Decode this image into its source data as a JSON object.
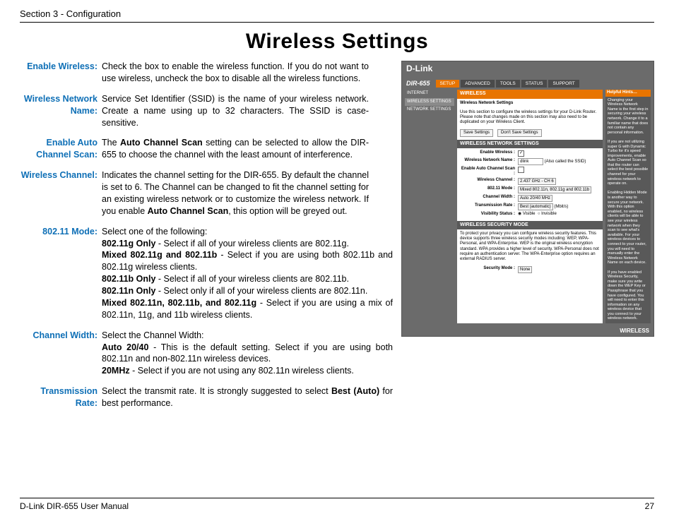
{
  "header": {
    "section": "Section 3 - Configuration"
  },
  "title": "Wireless Settings",
  "defs": [
    {
      "term": "Enable Wireless:",
      "html": "Check the box to enable the wireless function. If you do not want to use wireless, uncheck the box to disable all the wireless functions.",
      "narrow": true
    },
    {
      "term": "Wireless Network Name:",
      "html": "Service Set Identifier (SSID) is the name of your wireless network. Create a name using up to 32 characters. The SSID is case-sensitive.",
      "narrow": true
    },
    {
      "term": "Enable Auto Channel Scan:",
      "html": "The <b>Auto Channel Scan</b> setting can be selected to allow the DIR-655 to choose the channel with the least amount of interference.",
      "narrow": true
    },
    {
      "term": "Wireless Channel:",
      "html": "Indicates the channel setting for the DIR-655. By default the channel is set to 6. The Channel can be changed to fit the channel setting for an existing wireless network or to customize the wireless network. If you enable <b>Auto Channel Scan</b>, this option will be greyed out.",
      "narrow": true
    },
    {
      "term": "802.11 Mode:",
      "html": "Select one of the following:<br><b>802.11g Only</b> - Select if all of your wireless clients are 802.11g.<br><b>Mixed 802.11g and 802.11b</b> - Select if you are using both 802.11b and 802.11g wireless clients.<br><b>802.11b Only</b> - Select if all of your wireless clients are 802.11b.<br><b>802.11n Only</b> - Select only if all of your wireless clients are 802.11n.<br><b>Mixed 802.11n, 802.11b, and 802.11g</b> - Select if you are using a mix of 802.11n, 11g, and 11b wireless clients.",
      "narrow": false
    },
    {
      "term": "Channel Width:",
      "html": "Select the Channel Width:<br><b>Auto 20/40</b> - This is the default setting. Select if you are using both 802.11n and non-802.11n wireless devices.<br><b>20MHz</b> - Select if you are not using any 802.11n wireless clients.",
      "narrow": false
    },
    {
      "term": "Transmission Rate:",
      "html": "Select the transmit rate. It is strongly suggested to select <b>Best (Auto)</b> for best performance.",
      "narrow": false
    }
  ],
  "screenshot": {
    "brand": "D-Link",
    "model": "DIR-655",
    "tabs": [
      "SETUP",
      "ADVANCED",
      "TOOLS",
      "STATUS",
      "SUPPORT"
    ],
    "activeTab": "SETUP",
    "side": [
      "INTERNET",
      "WIRELESS SETTINGS",
      "NETWORK SETTINGS"
    ],
    "sideActive": "WIRELESS SETTINGS",
    "mainBar": "WIRELESS",
    "subBar": "Wireless Network Settings",
    "intro": "Use this section to configure the wireless settings for your D-Link Router. Please note that changes made on this section may also need to be duplicated on your Wireless Client.",
    "btnSave": "Save Settings",
    "btnDont": "Don't Save Settings",
    "panel1": "WIRELESS NETWORK SETTINGS",
    "form": {
      "enable": {
        "label": "Enable Wireless :",
        "checked": true
      },
      "ssid": {
        "label": "Wireless Network Name :",
        "value": "dlink",
        "note": "(Also called the SSID)"
      },
      "autoch": {
        "label": "Enable Auto Channel Scan :",
        "checked": false
      },
      "channel": {
        "label": "Wireless Channel :",
        "value": "2.437 GHz - CH 6"
      },
      "mode": {
        "label": "802.11 Mode :",
        "value": "Mixed 802.11n, 802.11g and 802.11b"
      },
      "width": {
        "label": "Channel Width :",
        "value": "Auto 20/40 MHz"
      },
      "trate": {
        "label": "Transmission Rate :",
        "value": "Best (automatic)",
        "note": "(Mbit/s)"
      },
      "vis": {
        "label": "Visibility Status :",
        "v1": "Visible",
        "v2": "Invisible"
      }
    },
    "panel2": "WIRELESS SECURITY MODE",
    "secIntro": "To protect your privacy you can configure wireless security features. This device supports three wireless security modes including: WEP, WPA-Personal, and WPA-Enterprise. WEP is the original wireless encryption standard. WPA provides a higher level of security. WPA-Personal does not require an authentication server. The WPA-Enterprise option requires an external RADIUS server.",
    "secMode": {
      "label": "Security Mode :",
      "value": "None"
    },
    "hintsTitle": "Helpful Hints…",
    "hints": "Changing your Wireless Network Name is the first step in securing your wireless network. Change it to a familiar name that does not contain any personal information.\n\nIf you are not utilizing super G with Dynamic Turbo for it's speed improvements, enable Auto Channel Scan so that the router can select the best possible channel for your wireless network to operate on.\n\nEnabling Hidden Mode is another way to secure your network. With this option enabled, no wireless clients will be able to see your wireless network when they scan to see what's available. For your wireless devices to connect to your router, you will need to manually enter the Wireless Network Name on each device.\n\nIf you have enabled Wireless Security, make sure you write down the WEP Key or Passphrase that you have configured. You will need to enter this information on any wireless device that you connect to your wireless network.",
    "footBrand": "WIRELESS"
  },
  "footer": {
    "left": "D-Link DIR-655 User Manual",
    "right": "27"
  }
}
